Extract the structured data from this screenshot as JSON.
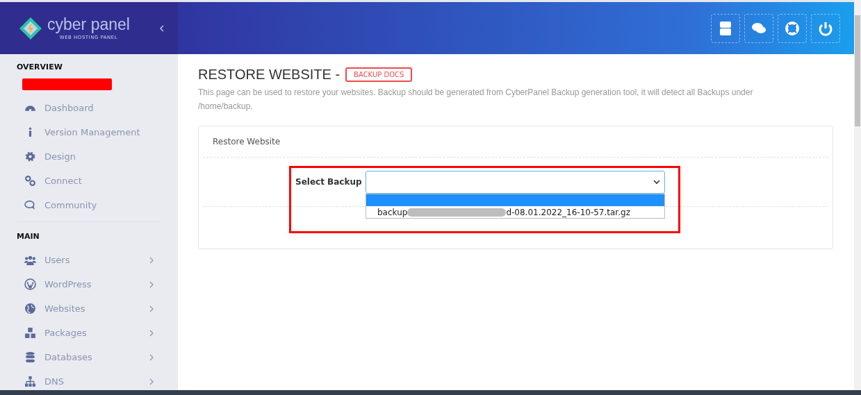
{
  "brand": {
    "name": "cyber panel",
    "tagline": "WEB HOSTING PANEL"
  },
  "sidebar": {
    "sections": [
      {
        "title": "OVERVIEW",
        "redacted_user": true,
        "items": [
          {
            "label": "Dashboard",
            "has_submenu": false
          },
          {
            "label": "Version Management",
            "has_submenu": false
          },
          {
            "label": "Design",
            "has_submenu": false
          },
          {
            "label": "Connect",
            "has_submenu": false
          },
          {
            "label": "Community",
            "has_submenu": false
          }
        ]
      },
      {
        "title": "MAIN",
        "redacted_user": false,
        "items": [
          {
            "label": "Users",
            "has_submenu": true
          },
          {
            "label": "WordPress",
            "has_submenu": true
          },
          {
            "label": "Websites",
            "has_submenu": true
          },
          {
            "label": "Packages",
            "has_submenu": true
          },
          {
            "label": "Databases",
            "has_submenu": true
          },
          {
            "label": "DNS",
            "has_submenu": true
          }
        ]
      }
    ]
  },
  "page": {
    "title": "RESTORE WEBSITE -",
    "docs_button": "BACKUP DOCS",
    "description": "This page can be used to restore your websites. Backup should be generated from CyberPanel Backup generation tool, it will detect all Backups under /home/backup."
  },
  "card": {
    "title": "Restore Website",
    "field_label": "Select Backup",
    "dropdown_open": true,
    "highlighted": true,
    "options": [
      {
        "selected": true
      },
      {
        "text_start": "backup",
        "text_end": "d-08.01.2022_16-10-57.tar.gz",
        "redacted": true,
        "selected": false
      }
    ]
  }
}
